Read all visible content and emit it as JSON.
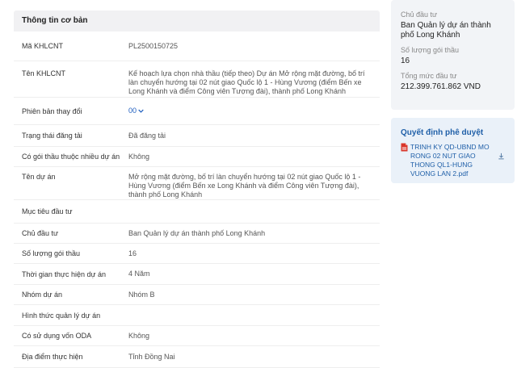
{
  "main": {
    "header": "Thông tin cơ bản",
    "rows": [
      {
        "label": "Mã KHLCNT",
        "value": "PL2500150725"
      },
      {
        "label": "Tên KHLCNT",
        "value": "Kế hoạch lựa chọn nhà thầu (tiếp theo) Dự án Mở rộng mặt đường, bố trí làn chuyển hướng tại 02 nút giao Quốc lộ 1 - Hùng Vương (điểm Bến xe Long Khánh và điểm Công viên Tượng đài), thành phố Long Khánh"
      },
      {
        "label": "Phiên bản thay đổi",
        "value": "00"
      },
      {
        "label": "Trạng thái đăng tải",
        "value": "Đã đăng tải"
      },
      {
        "label": "Có gói thầu thuộc nhiều dự án",
        "value": "Không"
      },
      {
        "label": "Tên dự án",
        "value": "Mở rộng mặt đường, bố trí làn chuyển hướng tại 02 nút giao Quốc lộ 1 - Hùng Vương (điểm Bến xe Long Khánh và điểm Công viên Tượng đài), thành phố Long Khánh"
      },
      {
        "label": "Mục tiêu đầu tư",
        "value": ""
      },
      {
        "label": "Chủ đầu tư",
        "value": "Ban Quản lý dự án thành phố Long Khánh"
      },
      {
        "label": "Số lượng gói thầu",
        "value": "16"
      },
      {
        "label": "Thời gian thực hiện dự án",
        "value": "4 Năm"
      },
      {
        "label": "Nhóm dự án",
        "value": "Nhóm B"
      },
      {
        "label": "Hình thức quản lý dự án",
        "value": ""
      },
      {
        "label": "Có sử dụng vốn ODA",
        "value": "Không"
      },
      {
        "label": "Địa điểm thực hiện",
        "value": "Tỉnh Đồng Nai"
      }
    ]
  },
  "sidebar": {
    "owner_label": "Chủ đầu tư",
    "owner_value": "Ban Quản lý dự án thành phố Long Khánh",
    "packages_label": "Số lượng gói thầu",
    "packages_value": "16",
    "investment_label": "Tổng mức đầu tư",
    "investment_value": "212.399.761.862 VND",
    "decision_title": "Quyết định phê duyệt",
    "decision_file": "TRINH KY QD-UBND MO RONG 02 NUT GIAO THONG QL1-HUNG VUONG LAN 2.pdf"
  },
  "colors": {
    "accent": "#1f5fa8",
    "pdf": "#d9362b"
  }
}
